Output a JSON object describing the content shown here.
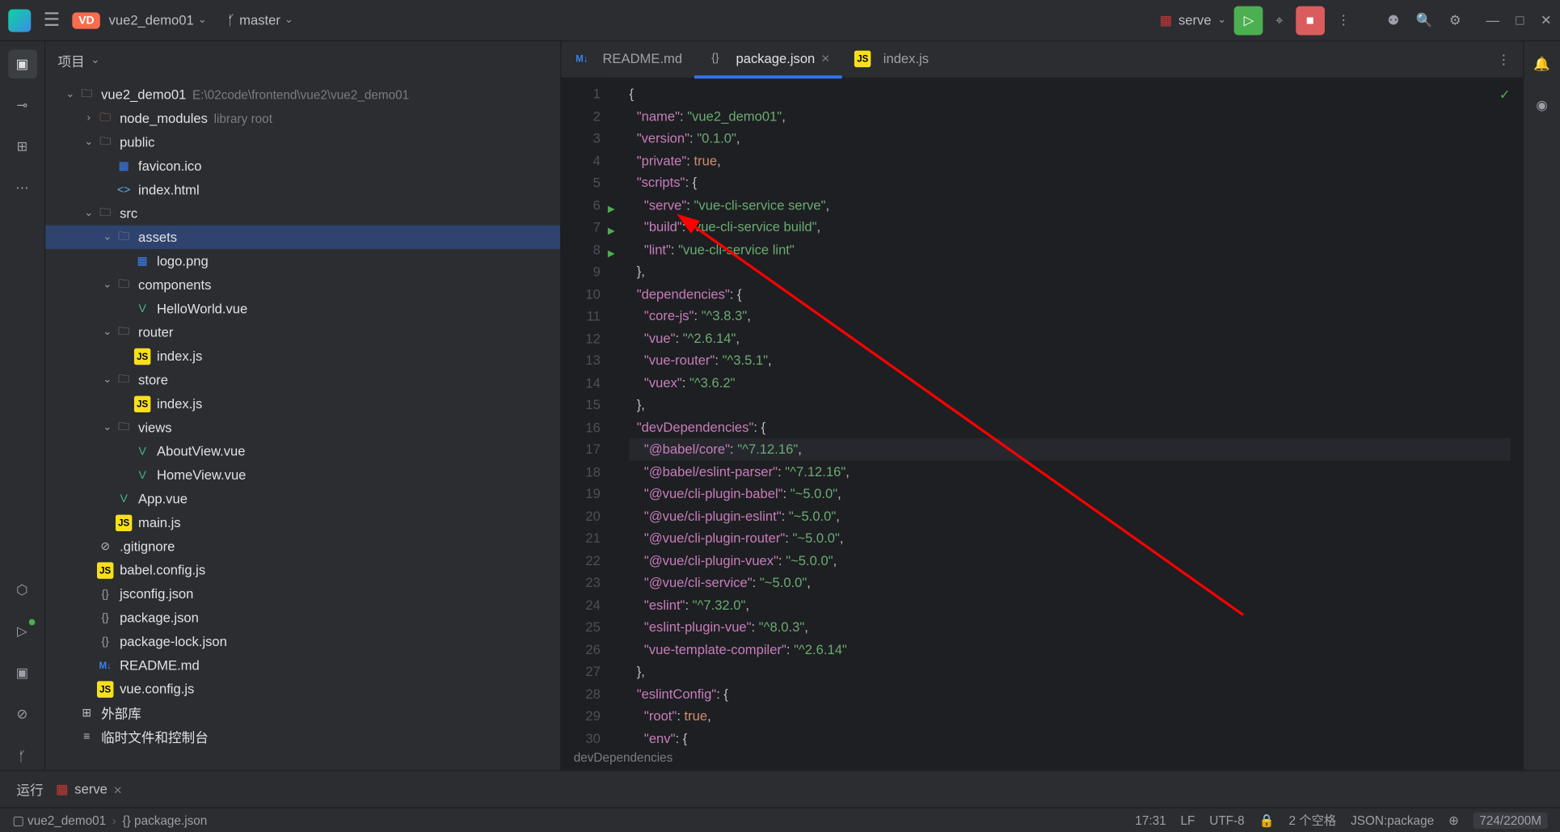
{
  "titlebar": {
    "vd": "VD",
    "project": "vue2_demo01",
    "branch": "master",
    "runConfig": "serve"
  },
  "panel": {
    "title": "项目"
  },
  "tree": [
    {
      "d": 0,
      "icon": "folder",
      "name": "vue2_demo01",
      "meta": "E:\\02code\\frontend\\vue2\\vue2_demo01",
      "chev": "down"
    },
    {
      "d": 1,
      "icon": "folder-orange",
      "name": "node_modules",
      "meta": "library root",
      "chev": "right"
    },
    {
      "d": 1,
      "icon": "folder",
      "name": "public",
      "chev": "down"
    },
    {
      "d": 2,
      "icon": "img",
      "name": "favicon.ico"
    },
    {
      "d": 2,
      "icon": "html",
      "name": "index.html"
    },
    {
      "d": 1,
      "icon": "folder",
      "name": "src",
      "chev": "down"
    },
    {
      "d": 2,
      "icon": "folder",
      "name": "assets",
      "chev": "down",
      "selected": true
    },
    {
      "d": 3,
      "icon": "img",
      "name": "logo.png"
    },
    {
      "d": 2,
      "icon": "folder",
      "name": "components",
      "chev": "down"
    },
    {
      "d": 3,
      "icon": "vue",
      "name": "HelloWorld.vue"
    },
    {
      "d": 2,
      "icon": "folder",
      "name": "router",
      "chev": "down"
    },
    {
      "d": 3,
      "icon": "js",
      "name": "index.js"
    },
    {
      "d": 2,
      "icon": "folder",
      "name": "store",
      "chev": "down"
    },
    {
      "d": 3,
      "icon": "js",
      "name": "index.js"
    },
    {
      "d": 2,
      "icon": "folder",
      "name": "views",
      "chev": "down"
    },
    {
      "d": 3,
      "icon": "vue",
      "name": "AboutView.vue"
    },
    {
      "d": 3,
      "icon": "vue",
      "name": "HomeView.vue"
    },
    {
      "d": 2,
      "icon": "vue",
      "name": "App.vue"
    },
    {
      "d": 2,
      "icon": "js",
      "name": "main.js"
    },
    {
      "d": 1,
      "icon": "git",
      "name": ".gitignore"
    },
    {
      "d": 1,
      "icon": "js",
      "name": "babel.config.js"
    },
    {
      "d": 1,
      "icon": "json",
      "name": "jsconfig.json"
    },
    {
      "d": 1,
      "icon": "json",
      "name": "package.json"
    },
    {
      "d": 1,
      "icon": "json",
      "name": "package-lock.json"
    },
    {
      "d": 1,
      "icon": "md",
      "name": "README.md"
    },
    {
      "d": 1,
      "icon": "js",
      "name": "vue.config.js"
    },
    {
      "d": 0,
      "icon": "lib",
      "name": "外部库"
    },
    {
      "d": 0,
      "icon": "scratch",
      "name": "临时文件和控制台"
    }
  ],
  "tabs": [
    {
      "icon": "md",
      "label": "README.md",
      "active": false,
      "closable": false
    },
    {
      "icon": "json",
      "label": "package.json",
      "active": true,
      "closable": true
    },
    {
      "icon": "js",
      "label": "index.js",
      "active": false,
      "closable": false
    }
  ],
  "code": {
    "lines": [
      {
        "n": 1,
        "html": "<span class='s-punc'>{</span>"
      },
      {
        "n": 2,
        "html": "  <span class='s-key'>\"name\"</span><span class='s-punc'>: </span><span class='s-str'>\"vue2_demo01\"</span><span class='s-punc'>,</span>"
      },
      {
        "n": 3,
        "html": "  <span class='s-key'>\"version\"</span><span class='s-punc'>: </span><span class='s-str'>\"0.1.0\"</span><span class='s-punc'>,</span>"
      },
      {
        "n": 4,
        "html": "  <span class='s-key'>\"private\"</span><span class='s-punc'>: </span><span class='s-bool'>true</span><span class='s-punc'>,</span>"
      },
      {
        "n": 5,
        "html": "  <span class='s-key'>\"scripts\"</span><span class='s-punc'>: {</span>"
      },
      {
        "n": 6,
        "run": true,
        "html": "    <span class='s-key'>\"serve\"</span><span class='s-punc'>: </span><span class='s-str'>\"vue-cli-service serve\"</span><span class='s-punc'>,</span>"
      },
      {
        "n": 7,
        "run": true,
        "html": "    <span class='s-key'>\"build\"</span><span class='s-punc'>: </span><span class='s-str'>\"vue-cli-service build\"</span><span class='s-punc'>,</span>"
      },
      {
        "n": 8,
        "run": true,
        "html": "    <span class='s-key'>\"lint\"</span><span class='s-punc'>: </span><span class='s-str'>\"vue-cli-service lint\"</span>"
      },
      {
        "n": 9,
        "html": "  <span class='s-punc'>},</span>"
      },
      {
        "n": 10,
        "html": "  <span class='s-key'>\"dependencies\"</span><span class='s-punc'>: {</span>"
      },
      {
        "n": 11,
        "html": "    <span class='s-key'>\"core-js\"</span><span class='s-punc'>: </span><span class='s-str'>\"^3.8.3\"</span><span class='s-punc'>,</span>"
      },
      {
        "n": 12,
        "html": "    <span class='s-key'>\"vue\"</span><span class='s-punc'>: </span><span class='s-str'>\"^2.6.14\"</span><span class='s-punc'>,</span>"
      },
      {
        "n": 13,
        "html": "    <span class='s-key'>\"vue-router\"</span><span class='s-punc'>: </span><span class='s-str'>\"^3.5.1\"</span><span class='s-punc'>,</span>"
      },
      {
        "n": 14,
        "html": "    <span class='s-key'>\"vuex\"</span><span class='s-punc'>: </span><span class='s-str'>\"^3.6.2\"</span>"
      },
      {
        "n": 15,
        "html": "  <span class='s-punc'>},</span>"
      },
      {
        "n": 16,
        "html": "  <span class='s-key'>\"devDependencies\"</span><span class='s-punc'>: {</span>"
      },
      {
        "n": 17,
        "hl": true,
        "html": "    <span class='s-key'>\"@babel/core\"</span><span class='s-punc'>: </span><span class='s-str'>\"^7.12.16\"</span><span class='s-punc'>,</span>"
      },
      {
        "n": 18,
        "html": "    <span class='s-key'>\"@babel/eslint-parser\"</span><span class='s-punc'>: </span><span class='s-str'>\"^7.12.16\"</span><span class='s-punc'>,</span>"
      },
      {
        "n": 19,
        "html": "    <span class='s-key'>\"@vue/cli-plugin-babel\"</span><span class='s-punc'>: </span><span class='s-str'>\"~5.0.0\"</span><span class='s-punc'>,</span>"
      },
      {
        "n": 20,
        "html": "    <span class='s-key'>\"@vue/cli-plugin-eslint\"</span><span class='s-punc'>: </span><span class='s-str'>\"~5.0.0\"</span><span class='s-punc'>,</span>"
      },
      {
        "n": 21,
        "html": "    <span class='s-key'>\"@vue/cli-plugin-router\"</span><span class='s-punc'>: </span><span class='s-str'>\"~5.0.0\"</span><span class='s-punc'>,</span>"
      },
      {
        "n": 22,
        "html": "    <span class='s-key'>\"@vue/cli-plugin-vuex\"</span><span class='s-punc'>: </span><span class='s-str'>\"~5.0.0\"</span><span class='s-punc'>,</span>"
      },
      {
        "n": 23,
        "html": "    <span class='s-key'>\"@vue/cli-service\"</span><span class='s-punc'>: </span><span class='s-str'>\"~5.0.0\"</span><span class='s-punc'>,</span>"
      },
      {
        "n": 24,
        "html": "    <span class='s-key'>\"eslint\"</span><span class='s-punc'>: </span><span class='s-str'>\"^7.32.0\"</span><span class='s-punc'>,</span>"
      },
      {
        "n": 25,
        "html": "    <span class='s-key'>\"eslint-plugin-vue\"</span><span class='s-punc'>: </span><span class='s-str'>\"^8.0.3\"</span><span class='s-punc'>,</span>"
      },
      {
        "n": 26,
        "html": "    <span class='s-key'>\"vue-template-compiler\"</span><span class='s-punc'>: </span><span class='s-str'>\"^2.6.14\"</span>"
      },
      {
        "n": 27,
        "html": "  <span class='s-punc'>},</span>"
      },
      {
        "n": 28,
        "html": "  <span class='s-key'>\"eslintConfig\"</span><span class='s-punc'>: {</span>"
      },
      {
        "n": 29,
        "html": "    <span class='s-key'>\"root\"</span><span class='s-punc'>: </span><span class='s-bool'>true</span><span class='s-punc'>,</span>"
      },
      {
        "n": 30,
        "html": "    <span class='s-key'>\"env\"</span><span class='s-punc'>: {</span>"
      }
    ],
    "breadcrumb": "devDependencies"
  },
  "runPanel": {
    "label": "运行",
    "config": "serve"
  },
  "status": {
    "crumb1": "vue2_demo01",
    "crumb2": "package.json",
    "time": "17:31",
    "eol": "LF",
    "enc": "UTF-8",
    "indent": "2 个空格",
    "lang": "JSON:package",
    "mem": "724/2200M"
  }
}
